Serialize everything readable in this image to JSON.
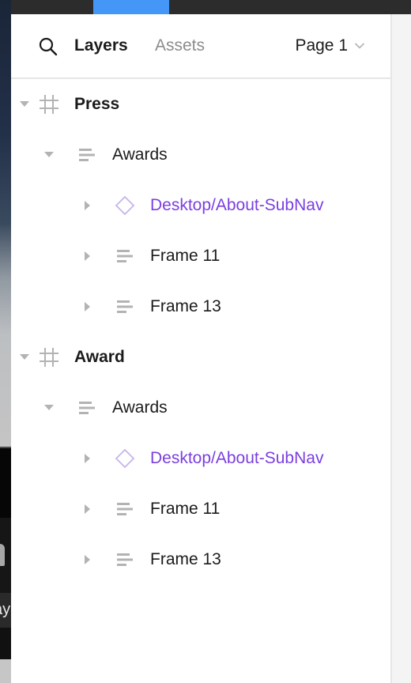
{
  "header": {
    "search_icon": "search-icon",
    "tabs": [
      {
        "label": "Layers",
        "active": true
      },
      {
        "label": "Assets",
        "active": false
      }
    ],
    "page_selector": {
      "label": "Page 1",
      "icon": "chevron-down-icon"
    }
  },
  "background": {
    "partial_text": "ay"
  },
  "colors": {
    "accent_blue": "#4597f7",
    "component_purple": "#7b3fe0",
    "component_icon": "#c6b5ea",
    "icon_grey": "#b3b3b3",
    "text_primary": "#1b1b1b",
    "text_muted": "#8c8c8c",
    "topbar": "#2c2c2c"
  },
  "layers": [
    {
      "label": "Press",
      "type": "frame",
      "level": 0,
      "expanded": true
    },
    {
      "label": "Awards",
      "type": "auto-layout",
      "level": 1,
      "expanded": true
    },
    {
      "label": "Desktop/About-SubNav",
      "type": "component-instance",
      "level": 2,
      "expanded": false
    },
    {
      "label": "Frame 11",
      "type": "auto-layout",
      "level": 2,
      "expanded": false
    },
    {
      "label": "Frame 13",
      "type": "auto-layout",
      "level": 2,
      "expanded": false
    },
    {
      "label": "Award",
      "type": "frame",
      "level": 0,
      "expanded": true
    },
    {
      "label": "Awards",
      "type": "auto-layout",
      "level": 1,
      "expanded": true
    },
    {
      "label": "Desktop/About-SubNav",
      "type": "component-instance",
      "level": 2,
      "expanded": false
    },
    {
      "label": "Frame 11",
      "type": "auto-layout",
      "level": 2,
      "expanded": false
    },
    {
      "label": "Frame 13",
      "type": "auto-layout",
      "level": 2,
      "expanded": false
    }
  ]
}
